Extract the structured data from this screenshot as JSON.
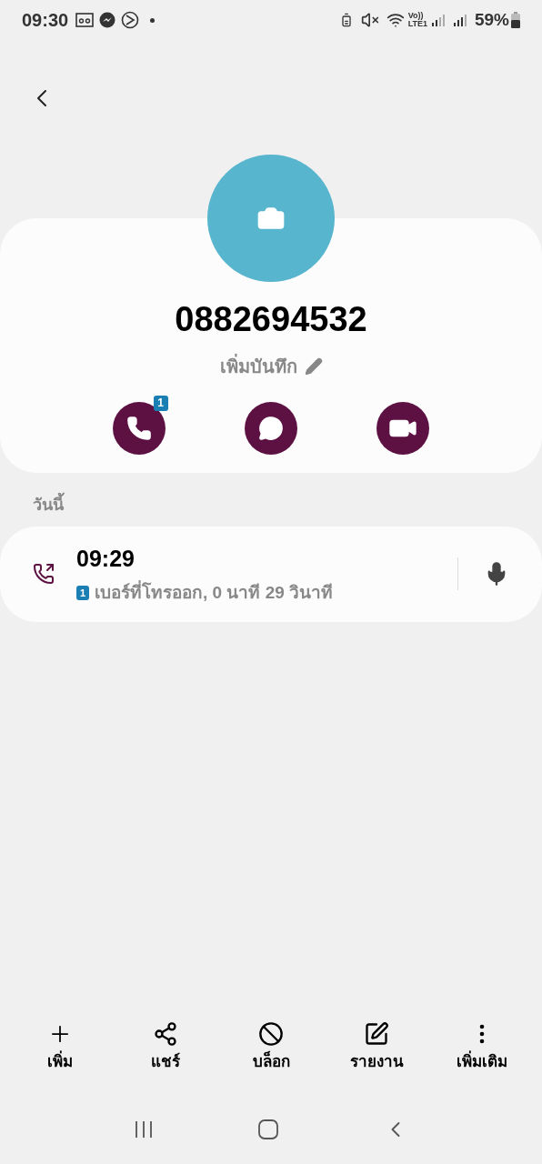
{
  "status_bar": {
    "time": "09:30",
    "network_top": "Vo))",
    "network_bottom": "LTE1",
    "battery": "59%"
  },
  "contact": {
    "number": "0882694532",
    "note": "เพิ่มบันทึก"
  },
  "actions": [
    {
      "kind": "call",
      "badge": "1"
    },
    {
      "kind": "message"
    },
    {
      "kind": "video"
    }
  ],
  "history": {
    "heading": "วันนี้",
    "entries": [
      {
        "time": "09:29",
        "sim": "1",
        "detail": "เบอร์ที่โทรออก, 0 นาที 29 วินาที"
      }
    ]
  },
  "bottom_bar": [
    {
      "kind": "add",
      "label": "เพิ่ม"
    },
    {
      "kind": "share",
      "label": "แชร์"
    },
    {
      "kind": "block",
      "label": "บล็อก"
    },
    {
      "kind": "report",
      "label": "รายงาน"
    },
    {
      "kind": "more",
      "label": "เพิ่มเติม"
    }
  ]
}
